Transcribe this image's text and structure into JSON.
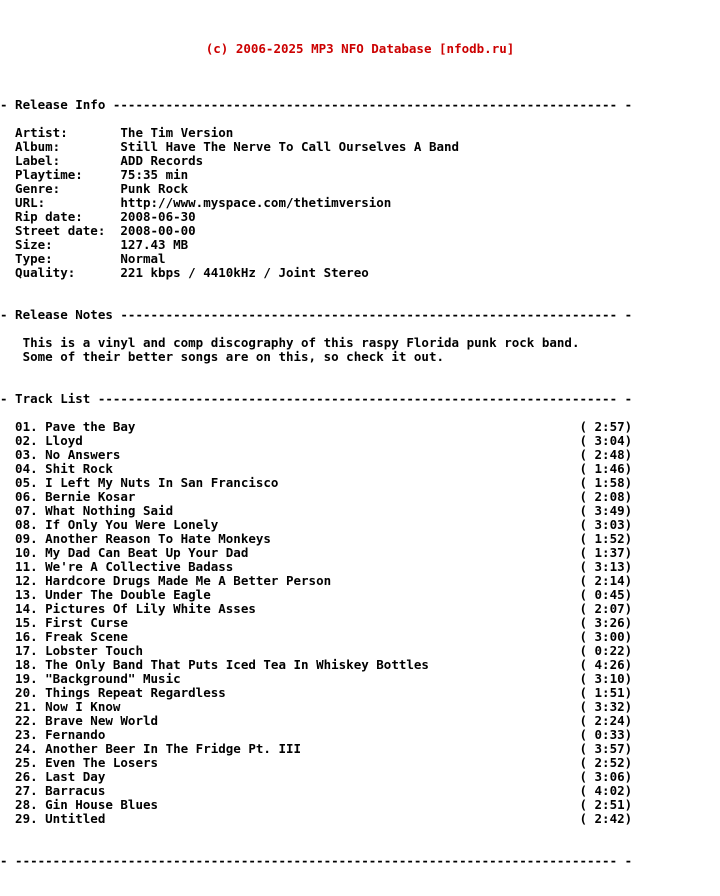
{
  "header": {
    "copyright": "(c) 2006-2025 MP3 NFO Database [nfodb.ru]",
    "color": "#cc0000"
  },
  "sections": {
    "release_info": {
      "label": "Release Info",
      "fields": [
        {
          "label": "Artist:",
          "value": "The Tim Version"
        },
        {
          "label": "Album:",
          "value": "Still Have The Nerve To Call Ourselves A Band"
        },
        {
          "label": "Label:",
          "value": "ADD Records"
        },
        {
          "label": "Playtime:",
          "value": "75:35 min"
        },
        {
          "label": "Genre:",
          "value": "Punk Rock"
        },
        {
          "label": "URL:",
          "value": "http://www.myspace.com/thetimversion"
        },
        {
          "label": "Rip date:",
          "value": "2008-06-30"
        },
        {
          "label": "Street date:",
          "value": "2008-00-00"
        },
        {
          "label": "Size:",
          "value": "127.43 MB"
        },
        {
          "label": "Type:",
          "value": "Normal"
        },
        {
          "label": "Quality:",
          "value": "221 kbps / 4410kHz / Joint Stereo"
        }
      ]
    },
    "release_notes": {
      "label": "Release Notes",
      "lines": [
        "This is a vinyl and comp discography of this raspy Florida punk rock band.",
        "Some of their better songs are on this, so check it out."
      ]
    },
    "track_list": {
      "label": "Track List",
      "tracks": [
        {
          "num": "01.",
          "title": "Pave the Bay",
          "time": "2:57"
        },
        {
          "num": "02.",
          "title": "Lloyd",
          "time": "3:04"
        },
        {
          "num": "03.",
          "title": "No Answers",
          "time": "2:48"
        },
        {
          "num": "04.",
          "title": "Shit Rock",
          "time": "1:46"
        },
        {
          "num": "05.",
          "title": "I Left My Nuts In San Francisco",
          "time": "1:58"
        },
        {
          "num": "06.",
          "title": "Bernie Kosar",
          "time": "2:08"
        },
        {
          "num": "07.",
          "title": "What Nothing Said",
          "time": "3:49"
        },
        {
          "num": "08.",
          "title": "If Only You Were Lonely",
          "time": "3:03"
        },
        {
          "num": "09.",
          "title": "Another Reason To Hate Monkeys",
          "time": "1:52"
        },
        {
          "num": "10.",
          "title": "My Dad Can Beat Up Your Dad",
          "time": "1:37"
        },
        {
          "num": "11.",
          "title": "We're A Collective Badass",
          "time": "3:13"
        },
        {
          "num": "12.",
          "title": "Hardcore Drugs Made Me A Better Person",
          "time": "2:14"
        },
        {
          "num": "13.",
          "title": "Under The Double Eagle",
          "time": "0:45"
        },
        {
          "num": "14.",
          "title": "Pictures Of Lily White Asses",
          "time": "2:07"
        },
        {
          "num": "15.",
          "title": "First Curse",
          "time": "3:26"
        },
        {
          "num": "16.",
          "title": "Freak Scene",
          "time": "3:00"
        },
        {
          "num": "17.",
          "title": "Lobster Touch",
          "time": "0:22"
        },
        {
          "num": "18.",
          "title": "The Only Band That Puts Iced Tea In Whiskey Bottles",
          "time": "4:26"
        },
        {
          "num": "19.",
          "title": "\"Background\" Music",
          "time": "3:10"
        },
        {
          "num": "20.",
          "title": "Things Repeat Regardless",
          "time": "1:51"
        },
        {
          "num": "21.",
          "title": "Now I Know",
          "time": "3:32"
        },
        {
          "num": "22.",
          "title": "Brave New World",
          "time": "2:24"
        },
        {
          "num": "23.",
          "title": "Fernando",
          "time": "0:33"
        },
        {
          "num": "24.",
          "title": "Another Beer In The Fridge Pt. III",
          "time": "3:57"
        },
        {
          "num": "25.",
          "title": "Even The Losers",
          "time": "2:52"
        },
        {
          "num": "26.",
          "title": "Last Day",
          "time": "3:06"
        },
        {
          "num": "27.",
          "title": "Barracus",
          "time": "4:02"
        },
        {
          "num": "28.",
          "title": "Gin House Blues",
          "time": "2:51"
        },
        {
          "num": "29.",
          "title": "Untitled",
          "time": "2:42"
        }
      ]
    },
    "footer": {
      "label": ""
    }
  },
  "layout": {
    "total_columns": 84,
    "label_column_width": 14,
    "track_time_column": 77,
    "dash_char": "-",
    "edge_char": "-"
  }
}
